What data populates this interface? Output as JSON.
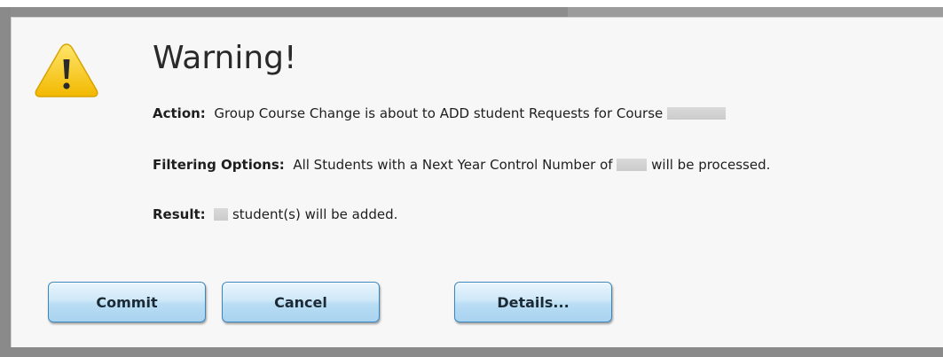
{
  "dialog": {
    "title": "Warning!",
    "icon": "warning-icon",
    "action": {
      "label": "Action:",
      "text": "Group Course Change is about to ADD student Requests for Course"
    },
    "filtering": {
      "label": "Filtering Options:",
      "text_before": "All Students with a Next Year Control Number of",
      "text_after": "will be processed."
    },
    "result": {
      "label": "Result:",
      "text_after": "student(s) will be added."
    }
  },
  "buttons": {
    "commit": "Commit",
    "cancel": "Cancel",
    "details": "Details..."
  },
  "colors": {
    "warning_yellow": "#f6c500",
    "button_blue": "#b9ddf4",
    "button_border": "#3a86bd"
  }
}
